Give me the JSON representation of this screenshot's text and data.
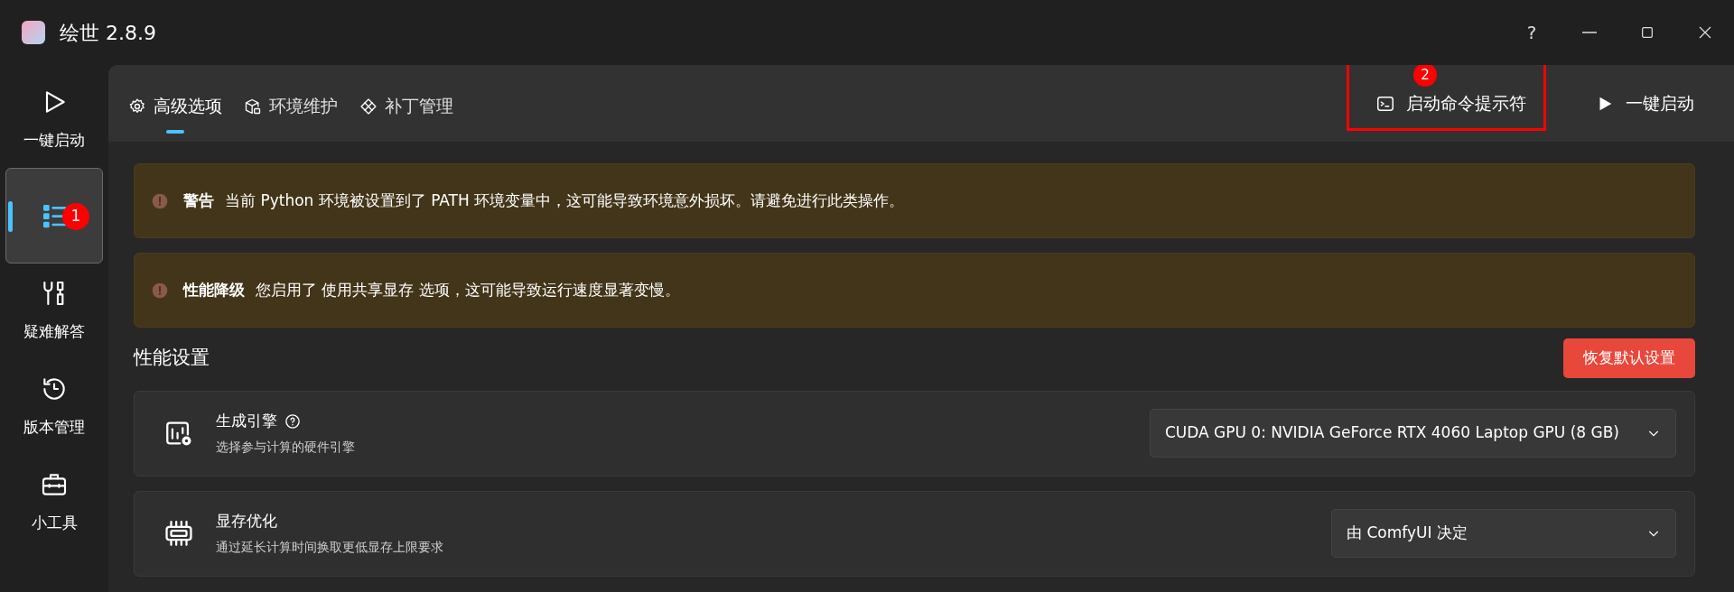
{
  "window": {
    "title": "绘世 2.8.9",
    "help_label": "?"
  },
  "sidebar": {
    "items": [
      {
        "kind": "play",
        "label": "一键启动",
        "selected": false
      },
      {
        "kind": "list",
        "selected": true,
        "badge": "1"
      },
      {
        "kind": "tools",
        "label": "疑难解答",
        "selected": false
      },
      {
        "kind": "history",
        "label": "版本管理",
        "selected": false
      },
      {
        "kind": "toolbox",
        "label": "小工具",
        "selected": false
      }
    ]
  },
  "tabs": [
    {
      "kind": "gear",
      "label": "高级选项",
      "selected": true
    },
    {
      "kind": "cube",
      "label": "环境维护",
      "selected": false
    },
    {
      "kind": "patch",
      "label": "补丁管理",
      "selected": false
    }
  ],
  "toolbar_buttons": [
    {
      "kind": "terminal",
      "label": "启动命令提示符",
      "annotation": "2"
    },
    {
      "kind": "play",
      "label": "一键启动"
    }
  ],
  "alerts": [
    {
      "title": "警告",
      "text": "当前 Python 环境被设置到了 PATH 环境变量中，这可能导致环境意外损坏。请避免进行此类操作。"
    },
    {
      "title": "性能降级",
      "text": "您启用了 使用共享显存 选项，这可能导致运行速度显著变慢。"
    }
  ],
  "section": {
    "title": "性能设置",
    "reset_button": "恢复默认设置"
  },
  "settings": [
    {
      "kind": "engine",
      "title": "生成引擎",
      "help": true,
      "description": "选择参与计算的硬件引擎",
      "value": "CUDA GPU 0: NVIDIA GeForce RTX 4060 Laptop GPU (8 GB)"
    },
    {
      "kind": "memory",
      "title": "显存优化",
      "help": false,
      "description": "通过延长计算时间换取更低显存上限要求",
      "value": "由 ComfyUI 决定"
    }
  ]
}
